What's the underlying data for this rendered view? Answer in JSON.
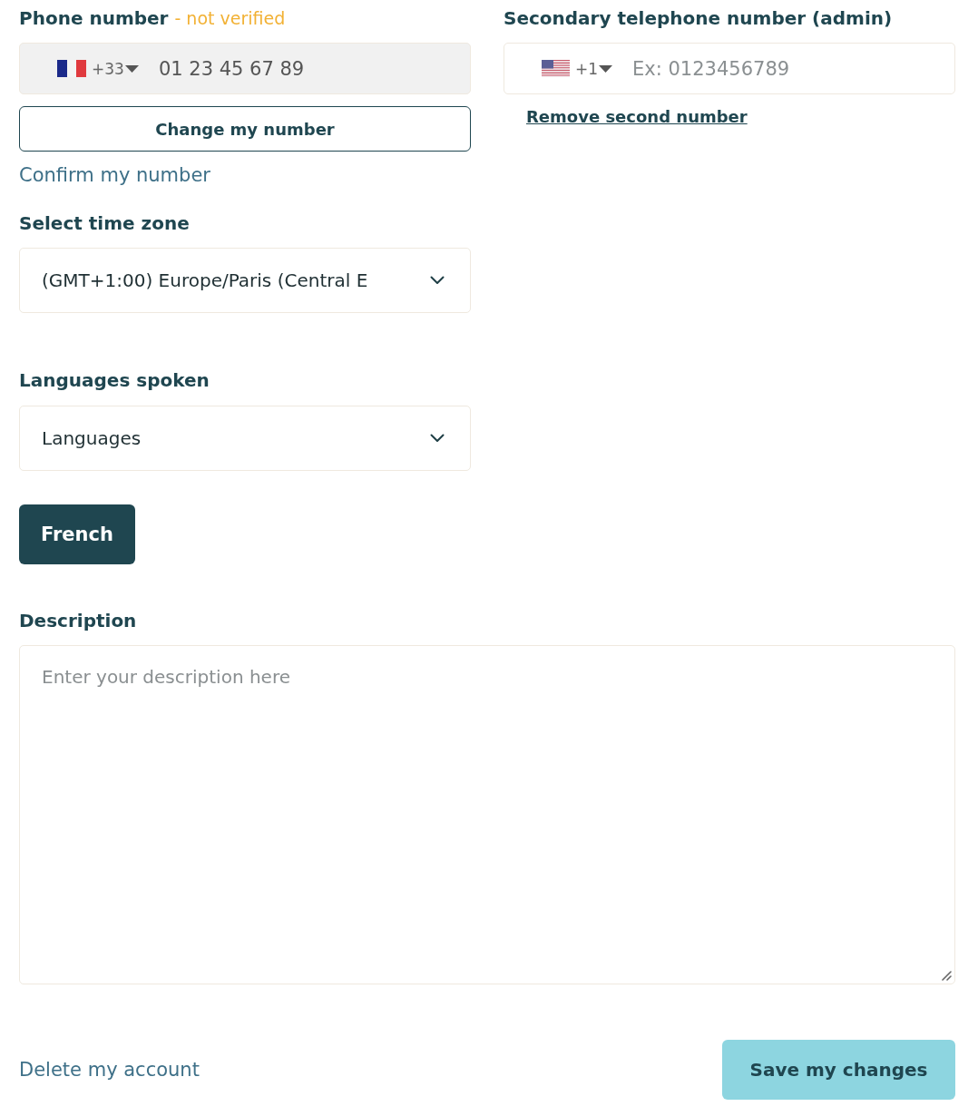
{
  "primary_phone": {
    "label": "Phone number",
    "status": "- not verified",
    "country_code": "+33",
    "value": "01 23 45 67 89",
    "disabled": true,
    "change_button": "Change my number",
    "confirm_link": "Confirm my number"
  },
  "secondary_phone": {
    "label": "Secondary telephone number (admin)",
    "country_code": "+1",
    "placeholder": "Ex: 0123456789",
    "disabled": false,
    "remove_link": "Remove second number"
  },
  "time_zone": {
    "label": "Select time zone",
    "value": "(GMT+1:00) Europe/Paris (Central E"
  },
  "languages": {
    "label": "Languages spoken",
    "prompt": "Languages",
    "chosen": [
      {
        "label": "French"
      }
    ]
  },
  "description": {
    "label": "Description",
    "placeholder": "Enter your description here"
  },
  "footer": {
    "delete_link": "Delete my account",
    "save_button": "Save my changes"
  }
}
